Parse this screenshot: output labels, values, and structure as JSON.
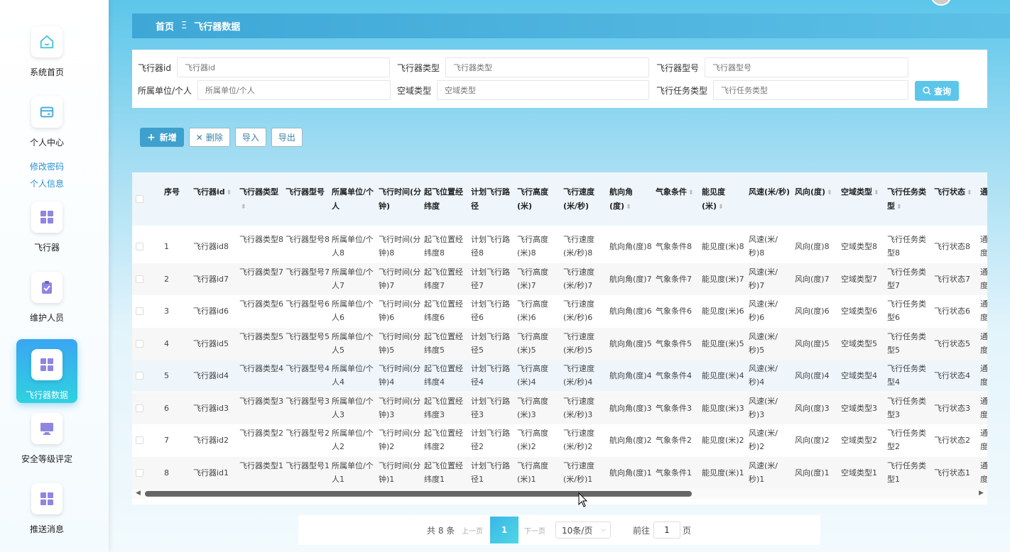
{
  "sidebar": {
    "items": [
      {
        "label": "系统首页",
        "icon": "home-icon"
      },
      {
        "label": "个人中心",
        "icon": "card-icon"
      },
      {
        "label": "飞行器",
        "icon": "grid-icon"
      },
      {
        "label": "维护人员",
        "icon": "clipboard-icon"
      },
      {
        "label": "飞行器数据",
        "icon": "grid-icon"
      },
      {
        "label": "安全等级评定",
        "icon": "monitor-icon"
      },
      {
        "label": "推送消息",
        "icon": "grid-icon"
      }
    ],
    "sub": [
      "修改密码",
      "个人信息"
    ]
  },
  "breadcrumb": {
    "home": "首页",
    "sep": "Ξ",
    "current": "飞行器数据"
  },
  "search": {
    "fields": [
      {
        "label": "飞行器id",
        "placeholder": "飞行器id"
      },
      {
        "label": "飞行器类型",
        "placeholder": "飞行器类型"
      },
      {
        "label": "飞行器型号",
        "placeholder": "飞行器型号"
      },
      {
        "label": "所属单位/个人",
        "placeholder": "所属单位/个人"
      },
      {
        "label": "空域类型",
        "placeholder": "空域类型"
      },
      {
        "label": "飞行任务类型",
        "placeholder": "飞行任务类型"
      }
    ],
    "query_label": "查询"
  },
  "actions": {
    "add": "新增",
    "delete": "删除",
    "import": "导入",
    "export": "导出"
  },
  "table": {
    "headers": [
      "序号",
      "飞行器id",
      "飞行器类型",
      "飞行器型号",
      "所属单位/个人",
      "飞行时间(分钟)",
      "起飞位置经纬度",
      "计划飞行路径",
      "飞行高度(米)",
      "飞行速度(米/秒)",
      "航向角(度)",
      "气象条件",
      "能见度(米)",
      "风速(米/秒)",
      "风向(度)",
      "空域类型",
      "飞行任务类型",
      "飞行状态",
      "通"
    ],
    "rows": [
      [
        "1",
        "飞行器id8",
        "飞行器类型8",
        "飞行器型号8",
        "所属单位/个人8",
        "飞行时间(分钟)8",
        "起飞位置经纬度8",
        "计划飞行路径8",
        "飞行高度(米)8",
        "飞行速度(米/秒)8",
        "航向角(度)8",
        "气象条件8",
        "能见度(米)8",
        "风速(米/秒)8",
        "风向(度)8",
        "空域类型8",
        "飞行任务类型8",
        "飞行状态8",
        "通度"
      ],
      [
        "2",
        "飞行器id7",
        "飞行器类型7",
        "飞行器型号7",
        "所属单位/个人7",
        "飞行时间(分钟)7",
        "起飞位置经纬度7",
        "计划飞行路径7",
        "飞行高度(米)7",
        "飞行速度(米/秒)7",
        "航向角(度)7",
        "气象条件7",
        "能见度(米)7",
        "风速(米/秒)7",
        "风向(度)7",
        "空域类型7",
        "飞行任务类型7",
        "飞行状态7",
        "通度"
      ],
      [
        "3",
        "飞行器id6",
        "飞行器类型6",
        "飞行器型号6",
        "所属单位/个人6",
        "飞行时间(分钟)6",
        "起飞位置经纬度6",
        "计划飞行路径6",
        "飞行高度(米)6",
        "飞行速度(米/秒)6",
        "航向角(度)6",
        "气象条件6",
        "能见度(米)6",
        "风速(米/秒)6",
        "风向(度)6",
        "空域类型6",
        "飞行任务类型6",
        "飞行状态6",
        "通度"
      ],
      [
        "4",
        "飞行器id5",
        "飞行器类型5",
        "飞行器型号5",
        "所属单位/个人5",
        "飞行时间(分钟)5",
        "起飞位置经纬度5",
        "计划飞行路径5",
        "飞行高度(米)5",
        "飞行速度(米/秒)5",
        "航向角(度)5",
        "气象条件5",
        "能见度(米)5",
        "风速(米/秒)5",
        "风向(度)5",
        "空域类型5",
        "飞行任务类型5",
        "飞行状态5",
        "通度"
      ],
      [
        "5",
        "飞行器id4",
        "飞行器类型4",
        "飞行器型号4",
        "所属单位/个人4",
        "飞行时间(分钟)4",
        "起飞位置经纬度4",
        "计划飞行路径4",
        "飞行高度(米)4",
        "飞行速度(米/秒)4",
        "航向角(度)4",
        "气象条件4",
        "能见度(米)4",
        "风速(米/秒)4",
        "风向(度)4",
        "空域类型4",
        "飞行任务类型4",
        "飞行状态4",
        "通度"
      ],
      [
        "6",
        "飞行器id3",
        "飞行器类型3",
        "飞行器型号3",
        "所属单位/个人3",
        "飞行时间(分钟)3",
        "起飞位置经纬度3",
        "计划飞行路径3",
        "飞行高度(米)3",
        "飞行速度(米/秒)3",
        "航向角(度)3",
        "气象条件3",
        "能见度(米)3",
        "风速(米/秒)3",
        "风向(度)3",
        "空域类型3",
        "飞行任务类型3",
        "飞行状态3",
        "通度"
      ],
      [
        "7",
        "飞行器id2",
        "飞行器类型2",
        "飞行器型号2",
        "所属单位/个人2",
        "飞行时间(分钟)2",
        "起飞位置经纬度2",
        "计划飞行路径2",
        "飞行高度(米)2",
        "飞行速度(米/秒)2",
        "航向角(度)2",
        "气象条件2",
        "能见度(米)2",
        "风速(米/秒)2",
        "风向(度)2",
        "空域类型2",
        "飞行任务类型2",
        "飞行状态2",
        "通度"
      ],
      [
        "8",
        "飞行器id1",
        "飞行器类型1",
        "飞行器型号1",
        "所属单位/个人1",
        "飞行时间(分钟)1",
        "起飞位置经纬度1",
        "计划飞行路径1",
        "飞行高度(米)1",
        "飞行速度(米/秒)1",
        "航向角(度)1",
        "气象条件1",
        "能见度(米)1",
        "风速(米/秒)1",
        "风向(度)1",
        "空域类型1",
        "飞行任务类型1",
        "飞行状态1",
        "通度"
      ]
    ]
  },
  "pagination": {
    "total": "共 8 条",
    "prev": "上一页",
    "current": "1",
    "next": "下一页",
    "page_size": "10条/页",
    "goto": "前往",
    "goto_value": "1",
    "page_unit": "页"
  },
  "colors": {
    "accent": "#5cc6ea",
    "active_grad_start": "#3aa6f2",
    "active_grad_end": "#2fd2e0",
    "icon": "#8f86e0"
  }
}
